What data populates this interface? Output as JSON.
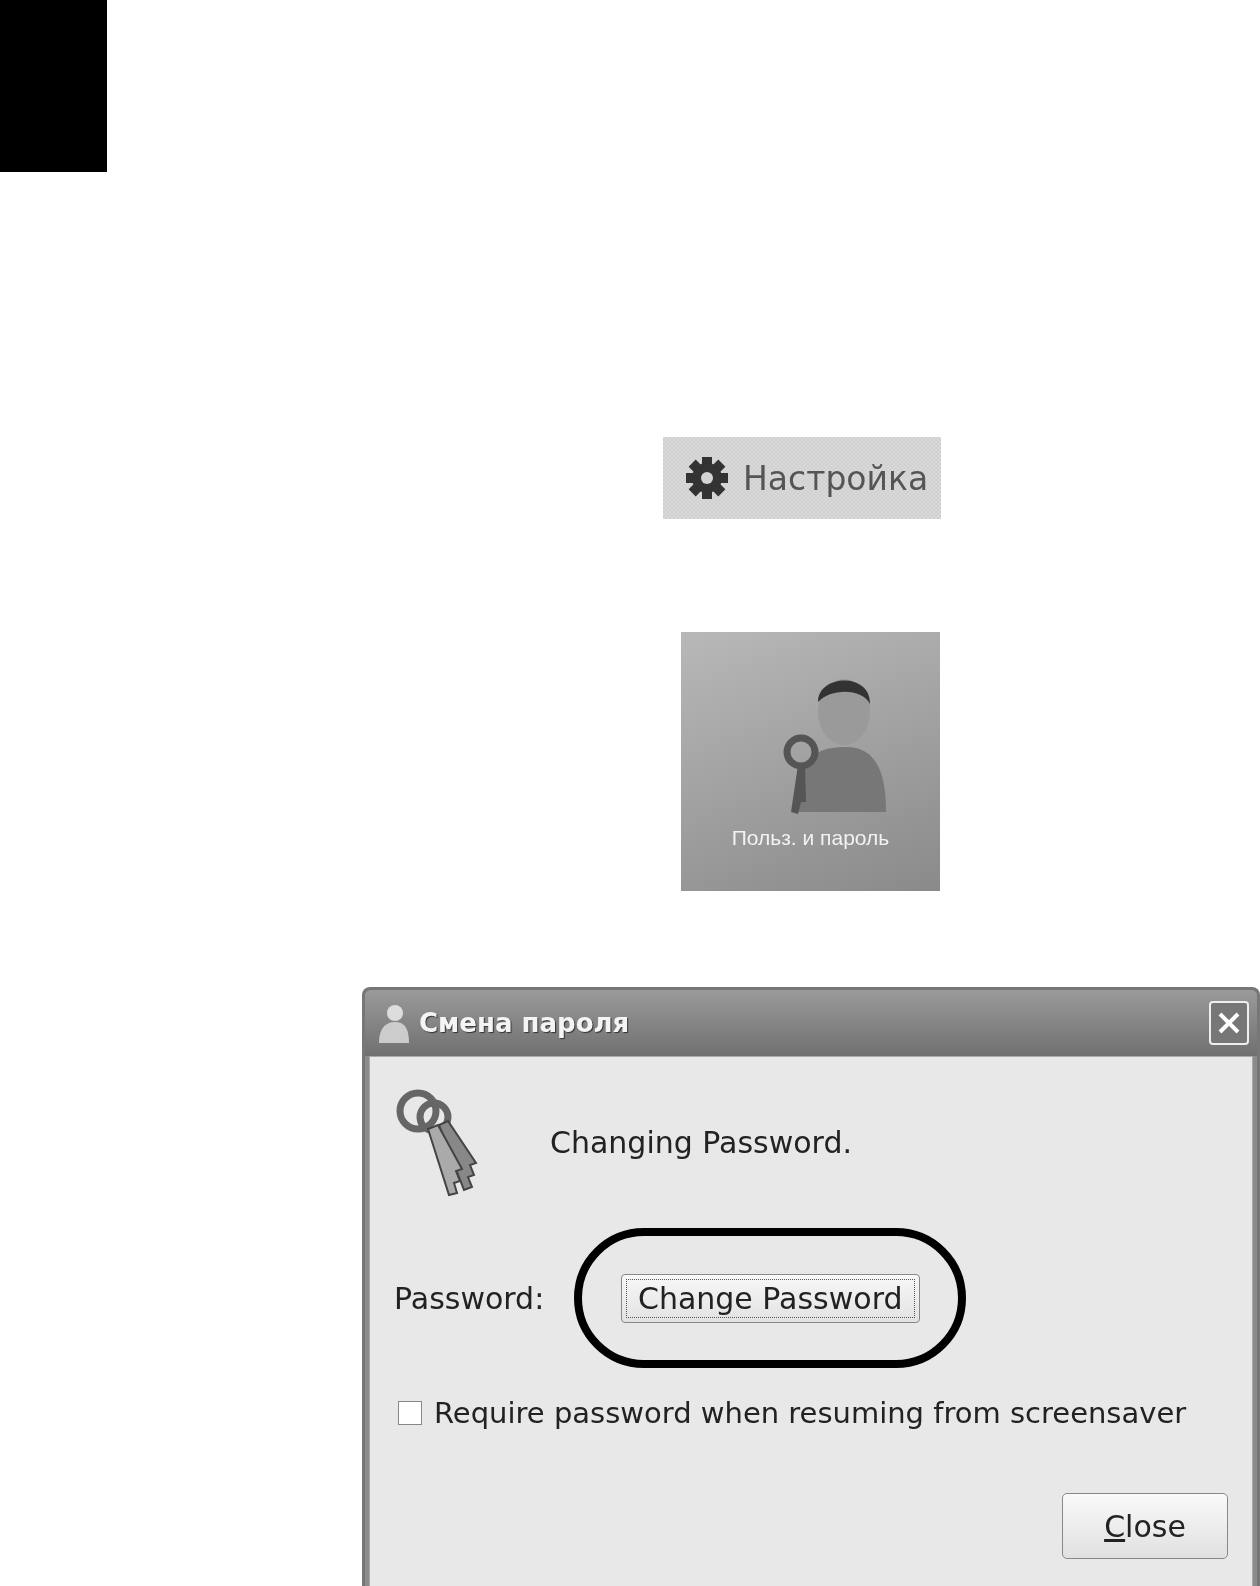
{
  "settings_button": {
    "label": "Настройка"
  },
  "users_tile": {
    "label": "Польз. и пароль"
  },
  "dialog": {
    "title": "Смена пароля",
    "message": "Changing Password.",
    "password_label": "Password:",
    "change_button": {
      "label": "Change Password",
      "highlighted": true
    },
    "screensaver_checkbox": {
      "label": "Require password when resuming from screensaver",
      "checked": false
    },
    "close_button": {
      "label": "Close"
    }
  }
}
